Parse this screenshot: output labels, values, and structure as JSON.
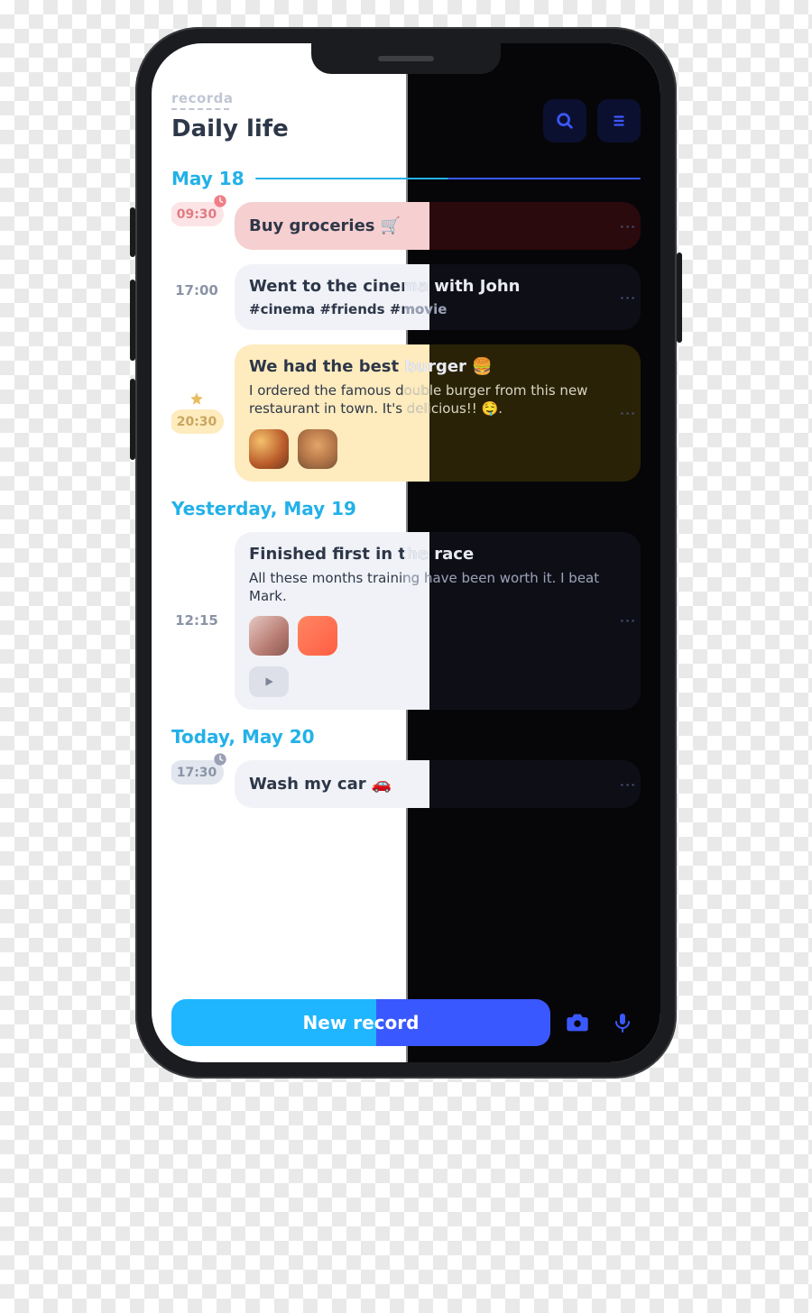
{
  "brand": "recorda",
  "title": "Daily life",
  "icons": {
    "search": "search-icon",
    "menu": "menu-icon",
    "camera": "camera-icon",
    "mic": "mic-icon"
  },
  "bottom": {
    "new_label": "New record"
  },
  "days": [
    {
      "label": "May 18",
      "entries": [
        {
          "time": "09:30",
          "time_style": "pink",
          "time_icon": "clock",
          "title": "Buy groceries 🛒",
          "card_style": "pink",
          "compact": true
        },
        {
          "time": "17:00",
          "time_style": "plain",
          "title": "Went to the cinema with John",
          "tags": "#cinema  #friends  #movie",
          "card_style": "grey"
        },
        {
          "time": "20:30",
          "time_style": "yellow",
          "time_icon": "star",
          "title": "We had the best burger 🍔",
          "body": "I ordered the famous double burger from this new restaurant in town. It's delicious!! 🤤.",
          "thumbs": [
            "burger1",
            "burger2"
          ],
          "card_style": "yellow"
        }
      ]
    },
    {
      "label": "Yesterday, May 19",
      "entries": [
        {
          "time": "12:15",
          "time_style": "plain",
          "title": "Finished first in the race",
          "body": "All these months training have been worth it. I beat Mark.",
          "thumbs": [
            "race1",
            "race2"
          ],
          "has_audio": true,
          "card_style": "grey2"
        }
      ]
    },
    {
      "label": "Today, May 20",
      "entries": [
        {
          "time": "17:30",
          "time_style": "grey",
          "time_icon": "clock_grey",
          "title": "Wash my car 🚗",
          "card_style": "grey",
          "compact": true
        }
      ]
    }
  ]
}
